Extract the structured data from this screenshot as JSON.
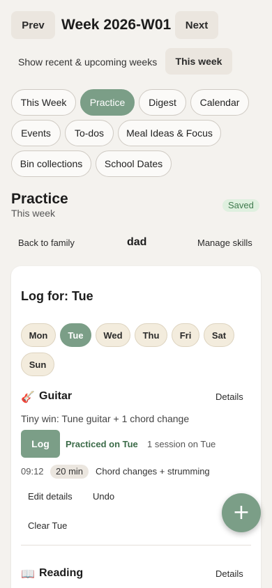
{
  "header": {
    "prev_label": "Prev",
    "title": "Week 2026-W01",
    "next_label": "Next"
  },
  "week_toggle": {
    "recent_label": "Show recent & upcoming weeks",
    "this_week_label": "This week"
  },
  "tabs": [
    {
      "label": "This Week",
      "active": false
    },
    {
      "label": "Practice",
      "active": true
    },
    {
      "label": "Digest",
      "active": false
    },
    {
      "label": "Calendar",
      "active": false
    },
    {
      "label": "Events",
      "active": false
    },
    {
      "label": "To-dos",
      "active": false
    },
    {
      "label": "Meal Ideas & Focus",
      "active": false
    },
    {
      "label": "Bin collections",
      "active": false
    },
    {
      "label": "School Dates",
      "active": false
    }
  ],
  "section": {
    "title": "Practice",
    "subtitle": "This week",
    "saved_badge": "Saved"
  },
  "subnav": {
    "back_label": "Back to family",
    "member_name": "dad",
    "manage_label": "Manage skills"
  },
  "log": {
    "heading": "Log for: Tue",
    "days": [
      {
        "label": "Mon",
        "active": false
      },
      {
        "label": "Tue",
        "active": true
      },
      {
        "label": "Wed",
        "active": false
      },
      {
        "label": "Thu",
        "active": false
      },
      {
        "label": "Fri",
        "active": false
      },
      {
        "label": "Sat",
        "active": false
      },
      {
        "label": "Sun",
        "active": false
      }
    ]
  },
  "skills": [
    {
      "icon": "🎸",
      "name": "Guitar",
      "details_label": "Details",
      "tiny_win": "Tiny win: Tune guitar + 1 chord change",
      "log_label": "Log",
      "practiced_label": "Practiced on Tue",
      "session_info": "1 session on Tue",
      "entry_time": "09:12",
      "entry_duration": "20 min",
      "entry_note": "Chord changes + strumming",
      "edit_label": "Edit details",
      "undo_label": "Undo",
      "clear_label": "Clear Tue"
    },
    {
      "icon": "📖",
      "name": "Reading",
      "details_label": "Details"
    }
  ],
  "fab": {
    "label": "+"
  },
  "colors": {
    "background": "#f4f2ee",
    "accent": "#7b9e87",
    "saved_badge_bg": "#dff0df",
    "saved_badge_text": "#3f7a4d",
    "practiced_text": "#3b6b48"
  }
}
